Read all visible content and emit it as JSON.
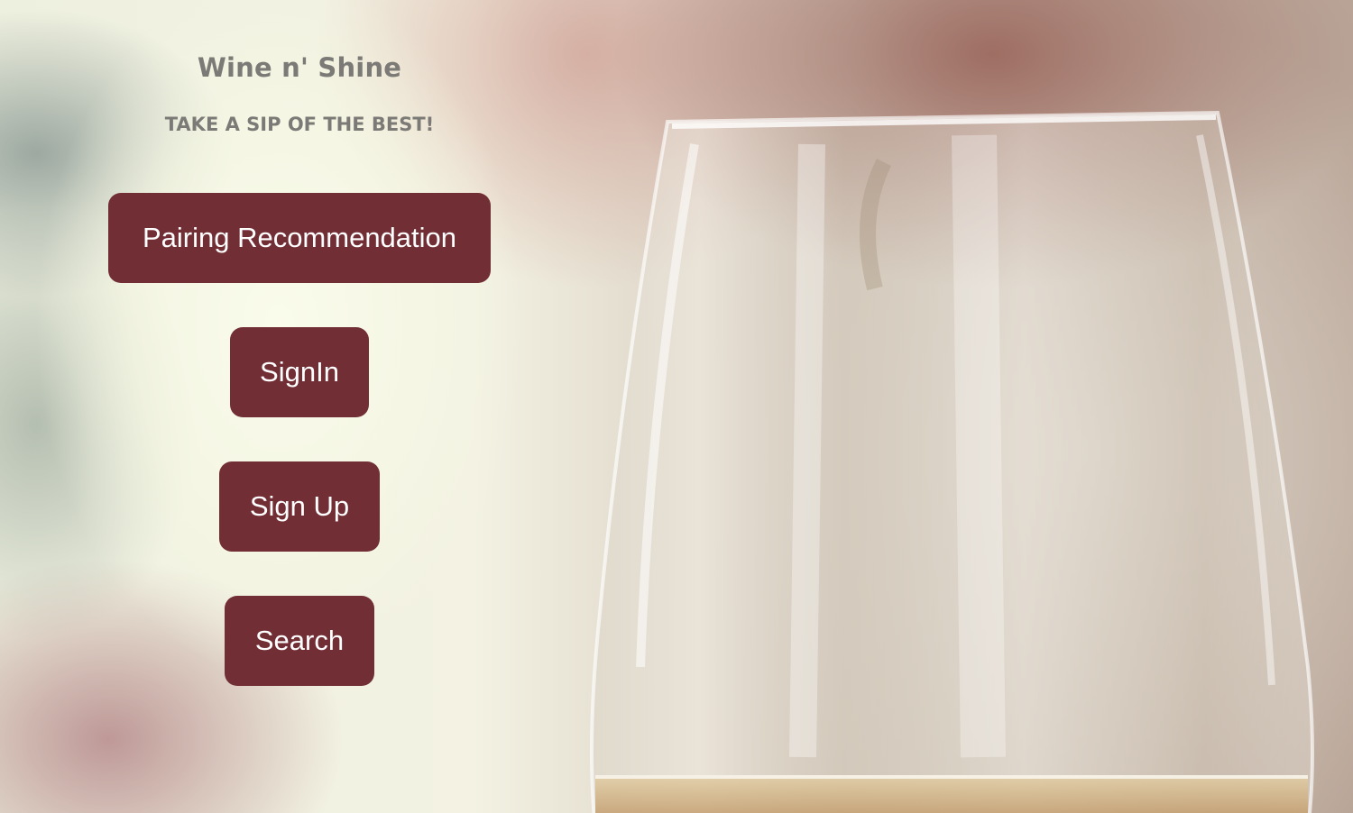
{
  "header": {
    "title": "Wine n' Shine",
    "tagline": "TAKE A SIP OF THE BEST!"
  },
  "actions": {
    "pairing_label": "Pairing Recommendation",
    "signin_label": "SignIn",
    "signup_label": "Sign Up",
    "search_label": "Search"
  },
  "colors": {
    "button_bg": "#722e35",
    "button_text": "#ffffff",
    "heading_text": "#7c7a76"
  }
}
